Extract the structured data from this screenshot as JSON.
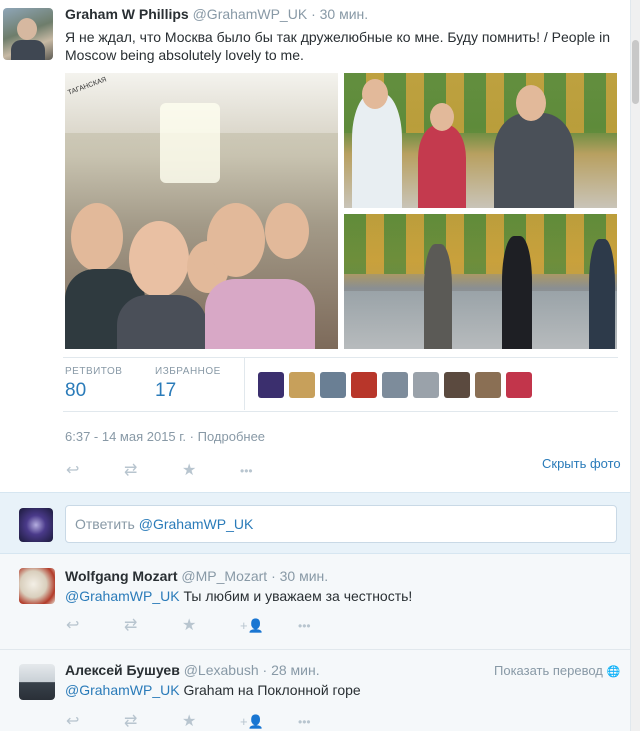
{
  "tweet": {
    "name": "Graham W Phillips",
    "handle": "@GrahamWP_UK",
    "time": "· 30 мин.",
    "text": "Я не ждал, что Москва было бы так дружелюбные ко мне. Буду помнить! / People in Moscow being absolutely lovely to me.",
    "retweets_label": "РЕТВИТОВ",
    "retweets_count": "80",
    "favorites_label": "ИЗБРАННОЕ",
    "favorites_count": "17",
    "datetime": "6:37 - 14 мая 2015 г.",
    "details_link": "· Подробнее",
    "hide_photo": "Скрыть фото",
    "photo_panel_text": "ТАГАНСКАЯ"
  },
  "reply_box": {
    "placeholder_prefix": "Ответить ",
    "mention": "@GrahamWP_UK"
  },
  "replies": [
    {
      "name": "Wolfgang Mozart",
      "handle": "@MP_Mozart",
      "time": "· 30 мин.",
      "mention": "@GrahamWP_UK",
      "text": "Ты любим и уважаем за честность!"
    },
    {
      "name": "Алексей Бушуев",
      "handle": "@Lexabush",
      "time": "· 28 мин.",
      "mention": "@GrahamWP_UK",
      "text": "Graham на Поклонной горе",
      "translate": "Показать перевод"
    }
  ],
  "icons": {
    "reply": "↩",
    "retweet": "⇄",
    "favorite": "★",
    "more": "•••",
    "follow": "+👤",
    "globe": "🌐"
  },
  "favoriter_colors": [
    "#3b2f6e",
    "#c7a05b",
    "#6a7f94",
    "#b8362a",
    "#7d8c9b",
    "#9aa2aa",
    "#5b4a3f",
    "#8a6f54",
    "#c2354b"
  ]
}
